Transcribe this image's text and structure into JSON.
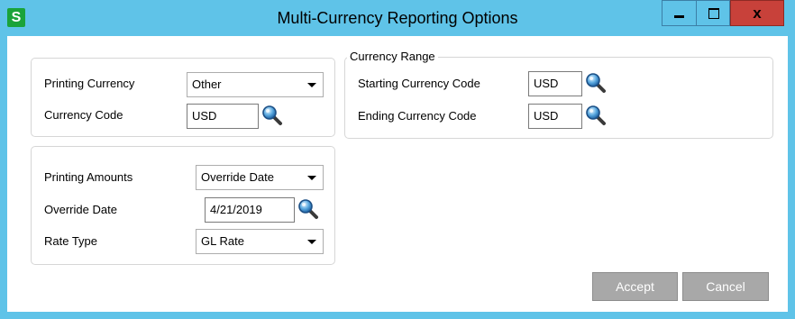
{
  "window": {
    "app_icon_letter": "S",
    "title": "Multi-Currency Reporting Options",
    "controls": {
      "minimize": "minimize",
      "maximize": "maximize",
      "close": "x"
    }
  },
  "printing_group": {
    "printing_currency_label": "Printing Currency",
    "printing_currency_value": "Other",
    "currency_code_label": "Currency Code",
    "currency_code_value": "USD"
  },
  "currency_range": {
    "legend": "Currency Range",
    "starting_label": "Starting Currency Code",
    "starting_value": "USD",
    "ending_label": "Ending Currency Code",
    "ending_value": "USD"
  },
  "amounts_group": {
    "printing_amounts_label": "Printing Amounts",
    "printing_amounts_value": "Override Date",
    "override_date_label": "Override Date",
    "override_date_value": "4/21/2019",
    "rate_type_label": "Rate Type",
    "rate_type_value": "GL Rate"
  },
  "buttons": {
    "accept": "Accept",
    "cancel": "Cancel"
  },
  "colors": {
    "titlebar": "#5fc3e8",
    "close_button": "#c8413a",
    "app_icon": "#1aa33a",
    "button_bg": "#a8a8a8"
  },
  "icons": {
    "lookup": "magnifier-icon"
  }
}
